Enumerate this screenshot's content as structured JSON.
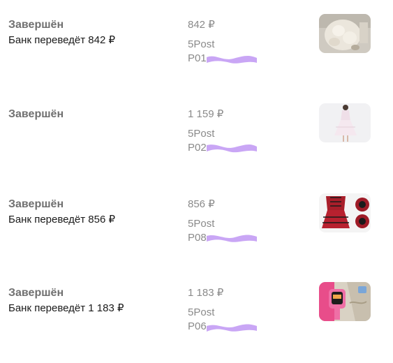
{
  "orders": [
    {
      "status": "Завершён",
      "refund": "Банк переведёт 842 ₽",
      "price": "842 ₽",
      "carrier": "5Post",
      "tracking_visible": "P01",
      "image": "plush-fur-bag-photo",
      "redaction_color": "#c9a6f5"
    },
    {
      "status": "Завершён",
      "refund": "",
      "price": "1 159 ₽",
      "carrier": "5Post",
      "tracking_visible": "P02",
      "image": "white-dress-model-photo",
      "redaction_color": "#c9a6f5"
    },
    {
      "status": "Завершён",
      "refund": "Банк переведёт 856 ₽",
      "price": "856 ₽",
      "carrier": "5Post",
      "tracking_visible": "P08",
      "image": "red-corset-dress-photo",
      "redaction_color": "#c9a6f5"
    },
    {
      "status": "Завершён",
      "refund": "Банк переведёт 1 183 ₽",
      "price": "1 183 ₽",
      "carrier": "5Post",
      "tracking_visible": "P06",
      "image": "pink-kids-smartwatch-photo",
      "redaction_color": "#c9a6f5"
    }
  ]
}
